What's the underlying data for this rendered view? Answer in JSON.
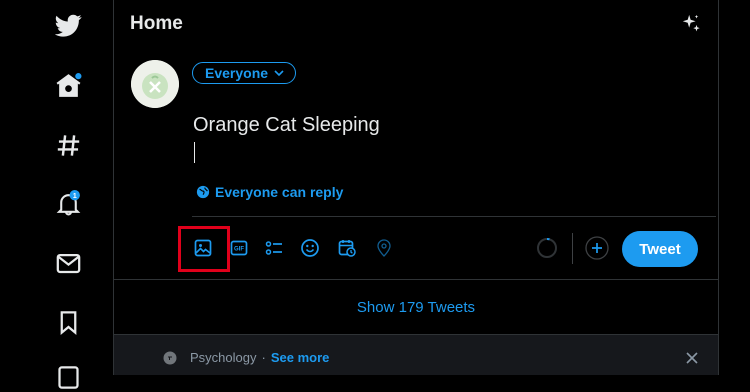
{
  "header": {
    "title": "Home"
  },
  "sidebar": {
    "notification_count": "1"
  },
  "composer": {
    "audience_label": "Everyone",
    "text": "Orange Cat Sleeping",
    "reply_setting": "Everyone can reply",
    "submit_label": "Tweet"
  },
  "feed": {
    "show_more_label": "Show 179 Tweets"
  },
  "topic": {
    "name": "Psychology",
    "separator": "·",
    "see_more": "See more"
  },
  "colors": {
    "accent": "#1d9bf0",
    "background": "#000000",
    "highlight": "#e0001b"
  },
  "icons": [
    "twitter-logo-icon",
    "home-icon",
    "explore-hashtag-icon",
    "notifications-bell-icon",
    "messages-envelope-icon",
    "bookmark-icon",
    "sparkle-icon",
    "image-media-icon",
    "gif-icon",
    "poll-icon",
    "emoji-icon",
    "schedule-icon",
    "location-icon",
    "add-thread-icon",
    "close-icon"
  ]
}
